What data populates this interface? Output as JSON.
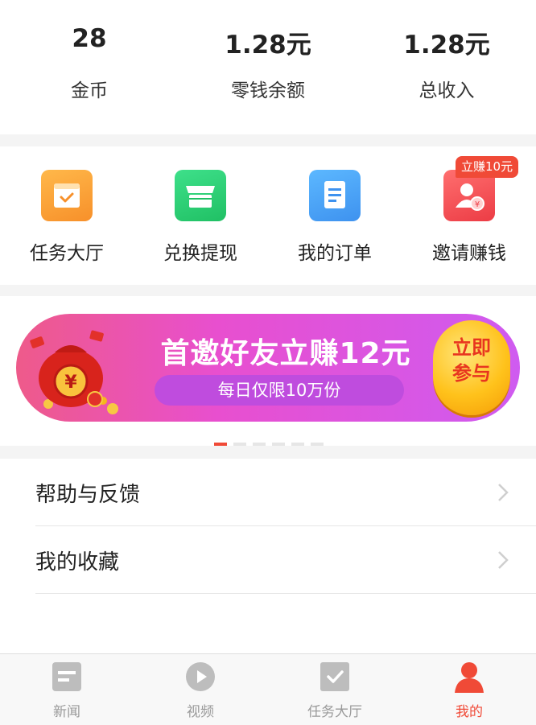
{
  "stats": [
    {
      "value": "28",
      "label": "金币"
    },
    {
      "value": "1.28元",
      "label": "零钱余额"
    },
    {
      "value": "1.28元",
      "label": "总收入"
    }
  ],
  "menu": {
    "items": [
      {
        "label": "任务大厅",
        "icon": "task-hall-icon",
        "color": "#f9a233"
      },
      {
        "label": "兑换提现",
        "icon": "store-icon",
        "color": "#2ecc71"
      },
      {
        "label": "我的订单",
        "icon": "order-icon",
        "color": "#4aa3f5"
      },
      {
        "label": "邀请赚钱",
        "icon": "invite-icon",
        "color": "#f0474a"
      }
    ],
    "invite_badge": "立赚10元"
  },
  "banner": {
    "title": "首邀好友立赚12元",
    "subtitle": "每日仅限10万份",
    "button_line1": "立即",
    "button_line2": "参与",
    "page_count": 6,
    "active_page": 1
  },
  "list": [
    {
      "label": "帮助与反馈"
    },
    {
      "label": "我的收藏"
    }
  ],
  "tabbar": [
    {
      "label": "新闻",
      "icon": "news-icon"
    },
    {
      "label": "视频",
      "icon": "video-play-icon"
    },
    {
      "label": "任务大厅",
      "icon": "task-check-icon"
    },
    {
      "label": "我的",
      "icon": "user-icon",
      "active": true
    }
  ],
  "colors": {
    "accent": "#f04a37",
    "inactive": "#9a9a9a"
  }
}
